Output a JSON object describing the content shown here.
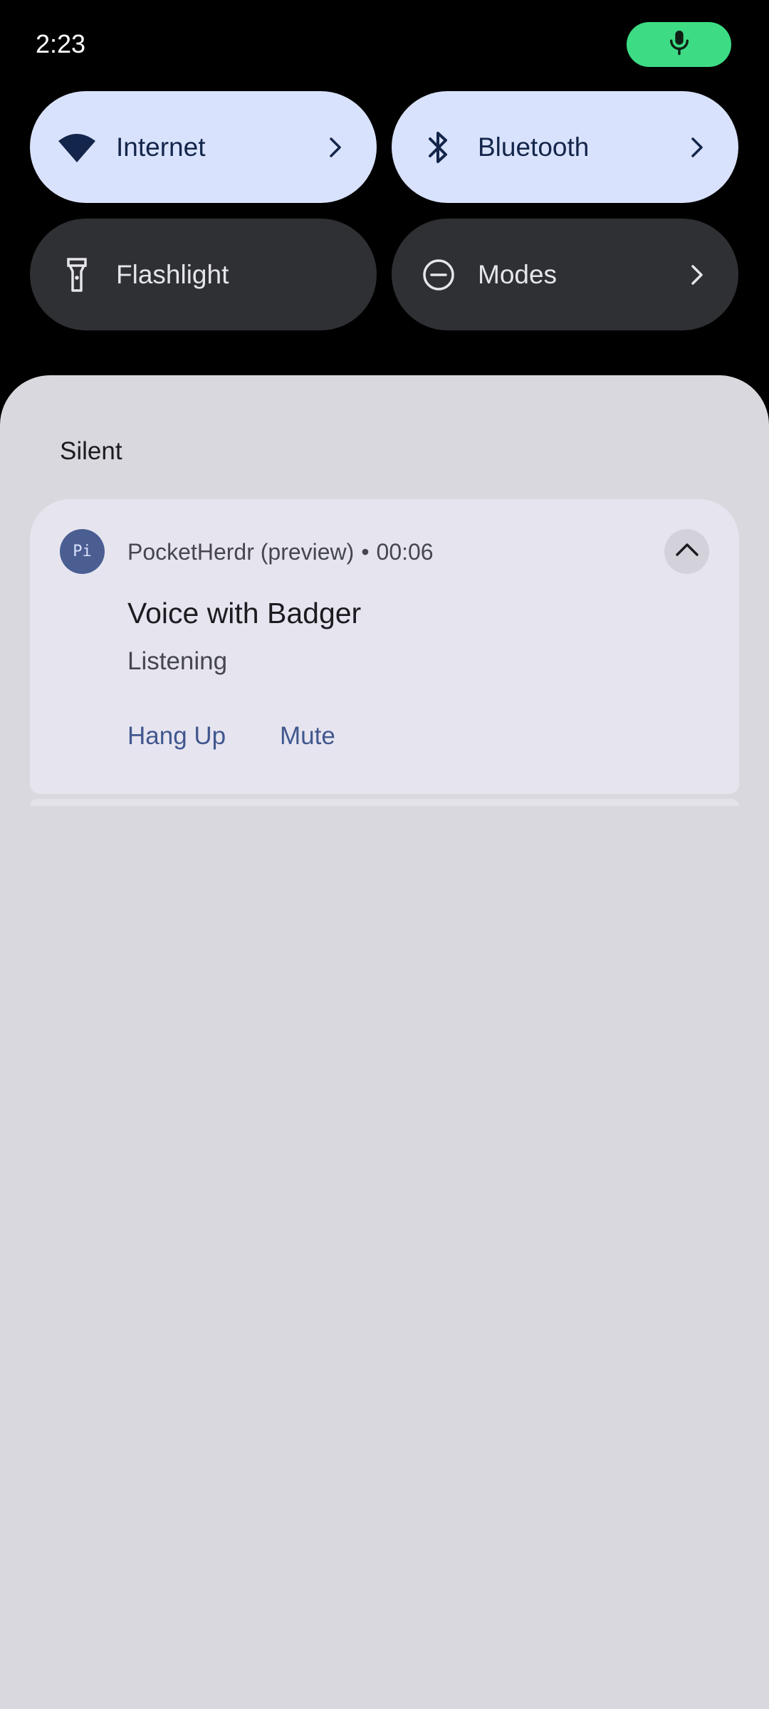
{
  "status_bar": {
    "time": "2:23",
    "mic_indicator_icon": "microphone-icon",
    "mic_indicator_color": "#3ddc84"
  },
  "quick_settings": {
    "tiles": [
      {
        "label": "Internet",
        "icon": "wifi-icon",
        "state": "on",
        "has_chevron": true
      },
      {
        "label": "Bluetooth",
        "icon": "bluetooth-icon",
        "state": "on",
        "has_chevron": true
      },
      {
        "label": "Flashlight",
        "icon": "flashlight-icon",
        "state": "off",
        "has_chevron": false
      },
      {
        "label": "Modes",
        "icon": "do-not-disturb-icon",
        "state": "off",
        "has_chevron": true
      }
    ]
  },
  "notifications": {
    "section_title": "Silent",
    "card": {
      "app_icon_text": "Pi",
      "app_name": "PocketHerdr (preview)",
      "separator": "•",
      "time": "00:06",
      "title": "Voice with Badger",
      "text": "Listening",
      "actions": [
        "Hang Up",
        "Mute"
      ]
    }
  },
  "colors": {
    "tile_active_bg": "#d9e2fc",
    "tile_inactive_bg": "#2f3034",
    "shade_bg": "#d9d8de",
    "card_bg": "#e6e5ef",
    "action_text": "#41578f"
  }
}
